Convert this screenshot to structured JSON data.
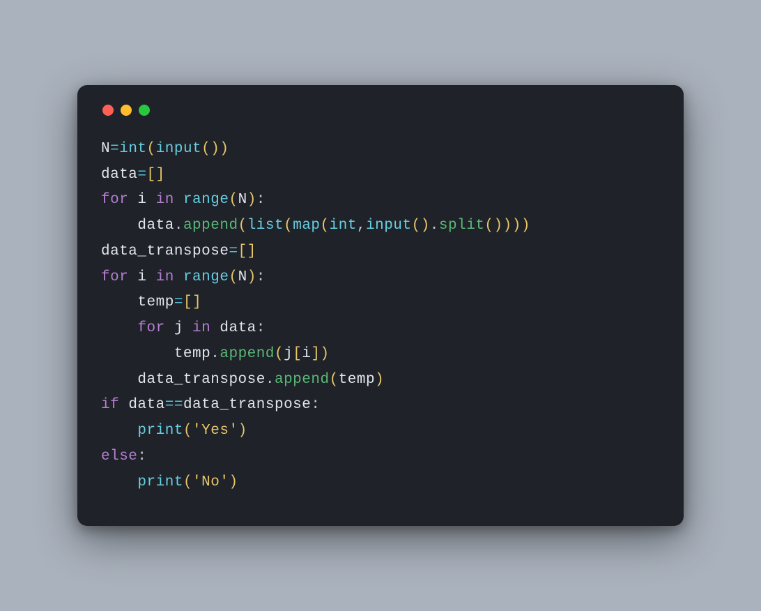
{
  "window": {
    "traffic_lights": {
      "red": "#ff5f56",
      "yellow": "#ffbd2e",
      "green": "#27c93f"
    }
  },
  "code": {
    "l1": {
      "a": "N",
      "b": "=",
      "c": "int",
      "d": "(",
      "e": "input",
      "f": "(",
      "g": ")",
      "h": ")"
    },
    "l2": {
      "a": "data",
      "b": "=",
      "c": "[",
      "d": "]"
    },
    "l3": {
      "a": "for",
      "b": " i ",
      "c": "in",
      "d": " ",
      "e": "range",
      "f": "(",
      "g": "N",
      "h": ")",
      "i": ":"
    },
    "l4": {
      "indent": "    ",
      "a": "data",
      "b": ".",
      "c": "append",
      "d": "(",
      "e": "list",
      "f": "(",
      "g": "map",
      "h": "(",
      "i": "int",
      "j": ",",
      "k": "input",
      "l": "(",
      "m": ")",
      "n": ".",
      "o": "split",
      "p": "(",
      "q": ")",
      "r": ")",
      "s": ")",
      "t": ")"
    },
    "l5": {
      "a": "data_transpose",
      "b": "=",
      "c": "[",
      "d": "]"
    },
    "l6": {
      "a": "for",
      "b": " i ",
      "c": "in",
      "d": " ",
      "e": "range",
      "f": "(",
      "g": "N",
      "h": ")",
      "i": ":"
    },
    "l7": {
      "indent": "    ",
      "a": "temp",
      "b": "=",
      "c": "[",
      "d": "]"
    },
    "l8": {
      "indent": "    ",
      "a": "for",
      "b": " j ",
      "c": "in",
      "d": " data",
      "e": ":"
    },
    "l9": {
      "indent": "        ",
      "a": "temp",
      "b": ".",
      "c": "append",
      "d": "(",
      "e": "j",
      "f": "[",
      "g": "i",
      "h": "]",
      "i": ")"
    },
    "l10": {
      "indent": "    ",
      "a": "data_transpose",
      "b": ".",
      "c": "append",
      "d": "(",
      "e": "temp",
      "f": ")"
    },
    "l11": {
      "a": "if",
      "b": " data",
      "c": "==",
      "d": "data_transpose",
      "e": ":"
    },
    "l12": {
      "indent": "    ",
      "a": "print",
      "b": "(",
      "c": "'Yes'",
      "d": ")"
    },
    "l13": {
      "a": "else",
      "b": ":"
    },
    "l14": {
      "indent": "    ",
      "a": "print",
      "b": "(",
      "c": "'No'",
      "d": ")"
    }
  }
}
